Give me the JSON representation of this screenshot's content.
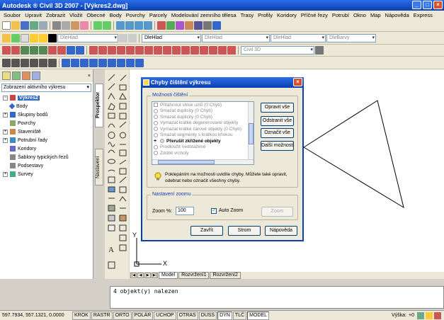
{
  "window": {
    "title": "Autodesk ® Civil 3D 2007 - [Výkres2.dwg]",
    "controls": [
      "_",
      "□",
      "×"
    ]
  },
  "menubar": [
    "Soubor",
    "Upravit",
    "Zobrazit",
    "Vložit",
    "Obecné",
    "Body",
    "Povrchy",
    "Parcely",
    "Modelování zemního tělesa",
    "Trasy",
    "Profily",
    "Koridory",
    "Příčné řezy",
    "Potrubí",
    "Okno",
    "Map",
    "Nápověda",
    "Express"
  ],
  "toolbar": {
    "layer_combo": "DleHlad",
    "color_combo": "DleHlad",
    "linetype_combo": "DleHlad",
    "lineweight_combo": "DleHlad",
    "plotstyle_combo": "DleBarvy",
    "workspace_combo": "Civil 3D"
  },
  "prospector": {
    "view_combo": "Zobrazení aktivního výkresu",
    "tab_prospector": "Prospektor",
    "tab_settings": "Nastavení",
    "tree": [
      {
        "label": "Výkres2",
        "root": true
      },
      {
        "label": "Body"
      },
      {
        "label": "Skupiny bodů"
      },
      {
        "label": "Povrchy"
      },
      {
        "label": "Staveniště"
      },
      {
        "label": "Potrubní řady"
      },
      {
        "label": "Koridory"
      },
      {
        "label": "Šablony typických řezů"
      },
      {
        "label": "Podsestavy"
      },
      {
        "label": "Survey"
      }
    ]
  },
  "layout_tabs": [
    "Model",
    "Rozvržení1",
    "Rozvržení2"
  ],
  "command_line": "4 objekt(y) nalezen",
  "ucs": {
    "x": "X",
    "y": "Y"
  },
  "statusbar": {
    "coords": "597.7934, 557.1321, 0.0000",
    "toggles": [
      "KROK",
      "RASTR",
      "ORTO",
      "POLÁR",
      "UCHOP",
      "OTRAS",
      "DUSS",
      "DYN",
      "TLČ",
      "MODEL"
    ],
    "elevation_label": "Výška:",
    "elevation_value": "+0"
  },
  "dialog": {
    "title": "Chyby čištění výkresu",
    "options_group": "Možnosti čištění",
    "options": [
      {
        "label": "Přitáhnout shluk uzlů (0 Chyb)",
        "kind": "box"
      },
      {
        "label": "Smazat duplicity (0 Chyb)",
        "kind": "circ"
      },
      {
        "label": "Smazat duplicity (0 Chyb)",
        "kind": "circ"
      },
      {
        "label": "Vymazat krátké degenerované objekty",
        "kind": "circ"
      },
      {
        "label": "Vymazat krátké čárové objekty (0 Chyb)",
        "kind": "circ"
      },
      {
        "label": "Smazat segmenty s krátkou křivkou",
        "kind": "circ"
      },
      {
        "label": "Přerušit zkřížené objekty",
        "kind": "strong"
      },
      {
        "label": "Prodloužit nedotažené",
        "kind": "circ"
      },
      {
        "label": "Zdobit vrcholy",
        "kind": "circ"
      }
    ],
    "buttons": {
      "fix_all": "Opravit vše",
      "remove_all": "Odstranit vše",
      "mark_all": "Označit vše",
      "more_options": "Další možnosti"
    },
    "hint": "Poklepáním na možnosti uvidíte chyby. Můžete také opravit, odebrat nebo označit všechny chyby.",
    "zoom_group": "Nastavení zoomu",
    "zoom_label": "Zoom %:",
    "zoom_value": "100",
    "auto_zoom_label": "Auto Zoom",
    "auto_zoom_checked": true,
    "zoom_button": "Zoom",
    "close_button": "Zavřít",
    "tree_button": "Strom",
    "help_button": "Nápověda"
  }
}
